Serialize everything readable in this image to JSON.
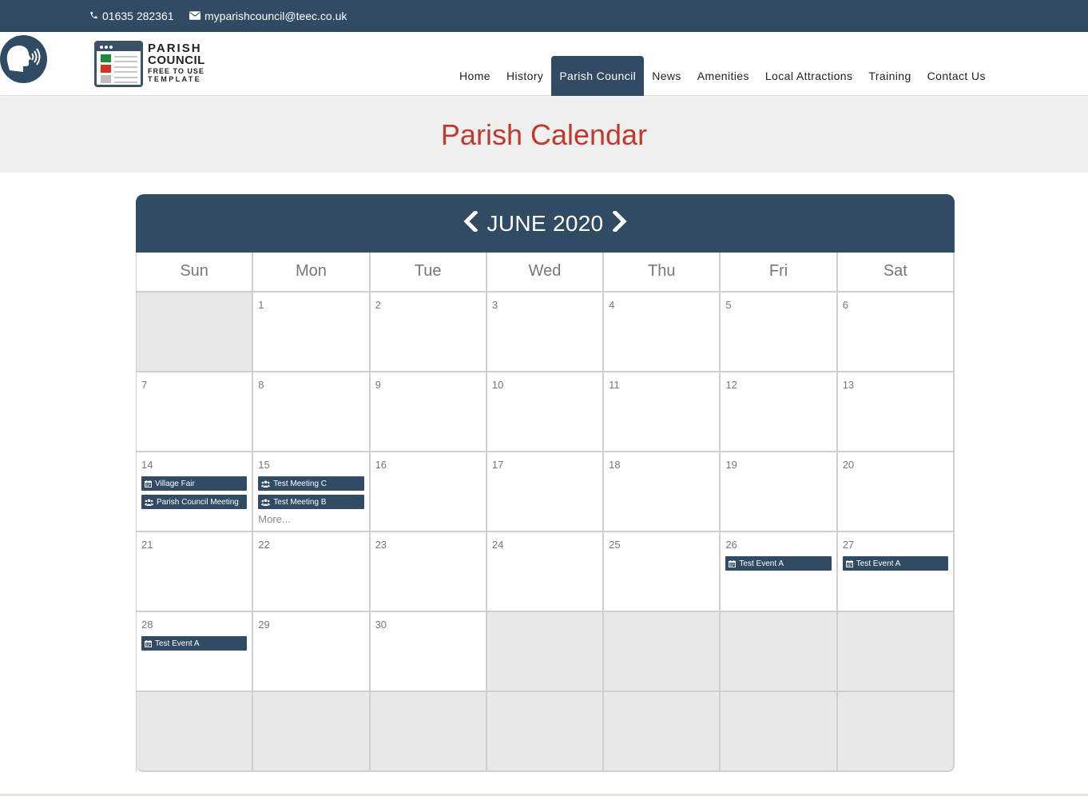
{
  "topbar": {
    "phone": "01635 282361",
    "email": "myparishcouncil@teec.co.uk"
  },
  "logo": {
    "line1": "PARISH",
    "line2": "COUNCIL",
    "line3": "FREE TO USE",
    "line4": "TEMPLATE"
  },
  "nav": {
    "items": [
      "Home",
      "History",
      "Parish Council",
      "News",
      "Amenities",
      "Local Attractions",
      "Training",
      "Contact Us"
    ],
    "active": "Parish Council"
  },
  "page": {
    "title": "Parish Calendar"
  },
  "calendar": {
    "month_label": "JUNE 2020",
    "days_of_week": [
      "Sun",
      "Mon",
      "Tue",
      "Wed",
      "Thu",
      "Fri",
      "Sat"
    ],
    "weeks": [
      [
        {
          "day": ""
        },
        {
          "day": "1"
        },
        {
          "day": "2"
        },
        {
          "day": "3"
        },
        {
          "day": "4"
        },
        {
          "day": "5"
        },
        {
          "day": "6"
        }
      ],
      [
        {
          "day": "7"
        },
        {
          "day": "8"
        },
        {
          "day": "9"
        },
        {
          "day": "10"
        },
        {
          "day": "11"
        },
        {
          "day": "12"
        },
        {
          "day": "13"
        }
      ],
      [
        {
          "day": "14",
          "events": [
            {
              "title": "Village Fair",
              "icon": "calendar-icon"
            },
            {
              "title": "Parish Council Meeting",
              "icon": "users-icon"
            }
          ]
        },
        {
          "day": "15",
          "events": [
            {
              "title": "Test Meeting C",
              "icon": "users-icon"
            },
            {
              "title": "Test Meeting B",
              "icon": "users-icon"
            }
          ],
          "more": "More..."
        },
        {
          "day": "16"
        },
        {
          "day": "17"
        },
        {
          "day": "18"
        },
        {
          "day": "19"
        },
        {
          "day": "20"
        }
      ],
      [
        {
          "day": "21"
        },
        {
          "day": "22"
        },
        {
          "day": "23"
        },
        {
          "day": "24"
        },
        {
          "day": "25"
        },
        {
          "day": "26",
          "events": [
            {
              "title": "Test Event A",
              "icon": "calendar-icon"
            }
          ]
        },
        {
          "day": "27",
          "events": [
            {
              "title": "Test Event A",
              "icon": "calendar-icon"
            }
          ]
        }
      ],
      [
        {
          "day": "28",
          "events": [
            {
              "title": "Test Event A",
              "icon": "calendar-icon"
            }
          ]
        },
        {
          "day": "29"
        },
        {
          "day": "30"
        },
        {
          "day": ""
        },
        {
          "day": ""
        },
        {
          "day": ""
        },
        {
          "day": ""
        }
      ],
      [
        {
          "day": ""
        },
        {
          "day": ""
        },
        {
          "day": ""
        },
        {
          "day": ""
        },
        {
          "day": ""
        },
        {
          "day": ""
        },
        {
          "day": ""
        }
      ]
    ]
  },
  "colors": {
    "primary": "#304b63",
    "title": "#c0392b",
    "empty_cell": "#e8e8e8"
  }
}
